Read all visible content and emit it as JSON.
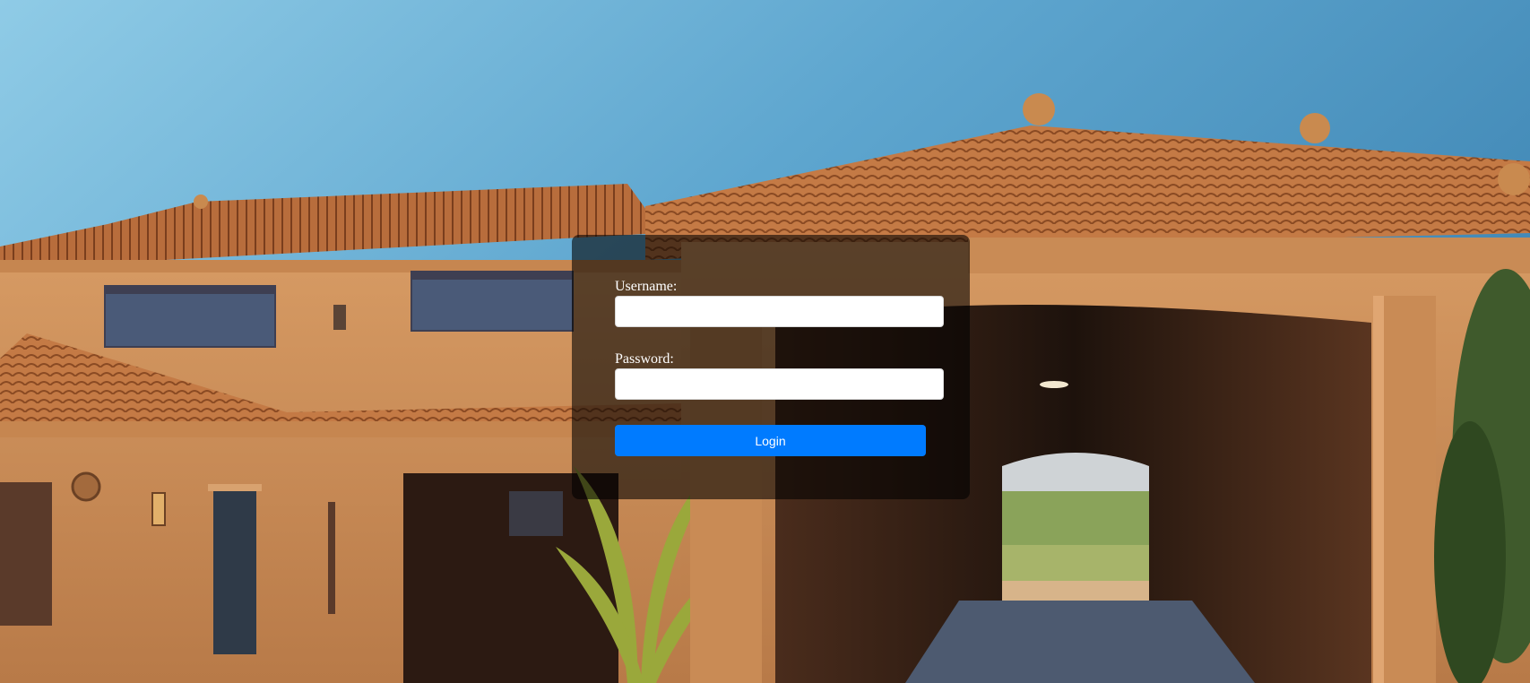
{
  "login_form": {
    "username_label": "Username:",
    "username_value": "",
    "password_label": "Password:",
    "password_value": "",
    "login_label": "Login"
  },
  "colors": {
    "panel_overlay": "rgba(0,0,0,0.58)",
    "button_accent": "#007bff",
    "label_text": "#ffffff"
  }
}
